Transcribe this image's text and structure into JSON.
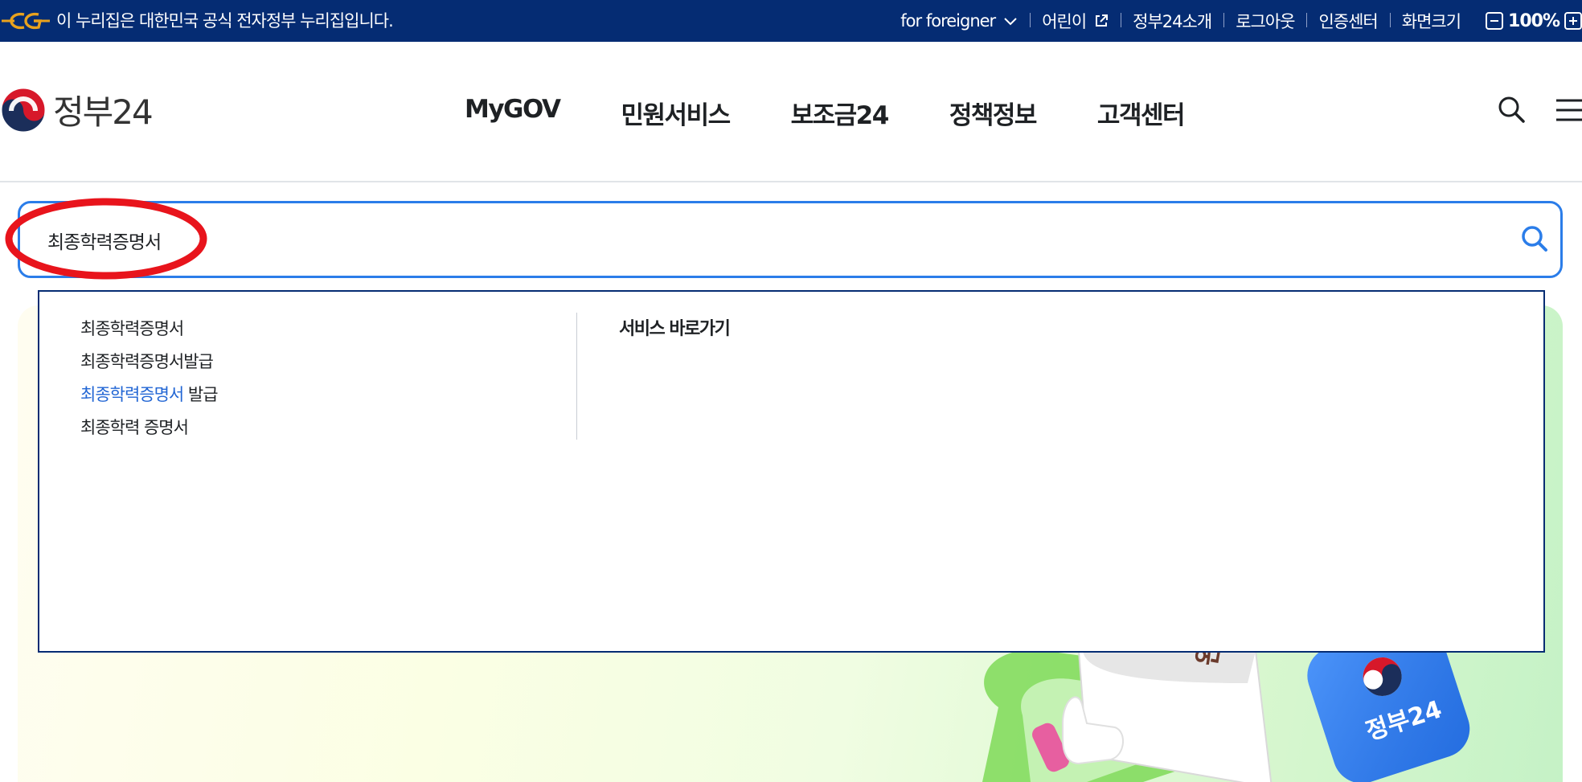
{
  "banner": {
    "text": "이 누리집은 대한민국 공식 전자정부 누리집입니다.",
    "links": [
      {
        "label": "for foreigner",
        "icon": "chevron-down-icon"
      },
      {
        "label": "어린이",
        "icon": "external-link-icon"
      },
      {
        "label": "정부24소개"
      },
      {
        "label": "로그아웃"
      },
      {
        "label": "인증센터"
      },
      {
        "label": "화면크기"
      }
    ],
    "zoom": {
      "value": "100%",
      "minus": "−",
      "plus": "+"
    }
  },
  "header": {
    "brand": "정부24",
    "nav": [
      "MyGOV",
      "민원서비스",
      "보조금24",
      "정책정보",
      "고객센터"
    ],
    "icons": [
      "search-icon",
      "hamburger-menu-icon"
    ]
  },
  "search": {
    "value": "최종학력증명서",
    "submit_icon": "search-icon",
    "accent_color": "#2b7de9"
  },
  "autocomplete": {
    "suggestions": [
      {
        "match": "",
        "rest": "최종학력증명서"
      },
      {
        "match": "",
        "rest": "최종학력증명서발급"
      },
      {
        "match": "최종학력증명서",
        "rest": " 발급"
      },
      {
        "match": "",
        "rest": "최종학력 증명서"
      }
    ],
    "shortcut_title": "서비스 바로가기",
    "highlight_color": "#2266d4"
  },
  "hero": {
    "app_tile_text": "정부24",
    "paper_text": "완료"
  },
  "colors": {
    "banner_bg": "#052c73",
    "annotation_red": "#e8141c"
  }
}
